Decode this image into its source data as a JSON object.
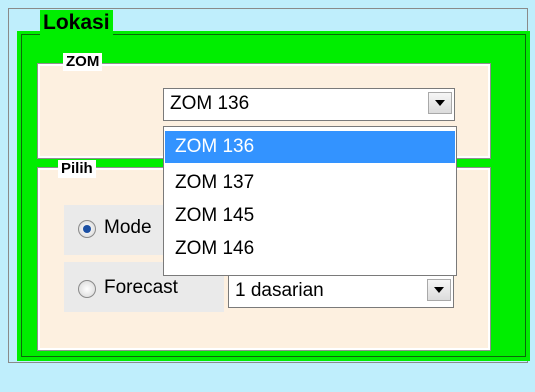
{
  "lokasi": {
    "title": "Lokasi"
  },
  "zom": {
    "label": "ZOM",
    "selected": "ZOM 136",
    "options": [
      "ZOM 136",
      "ZOM 137",
      "ZOM 145",
      "ZOM 146"
    ]
  },
  "pilih": {
    "label": "Pilih",
    "model_label": "Mode",
    "forecast_label": "Forecast",
    "model_checked": true,
    "dasarian_value": "1 dasarian"
  },
  "colors": {
    "background": "#bfeefc",
    "group_green": "#00ee00",
    "panel_bg": "#fdf0e0",
    "selection": "#3393ff"
  }
}
